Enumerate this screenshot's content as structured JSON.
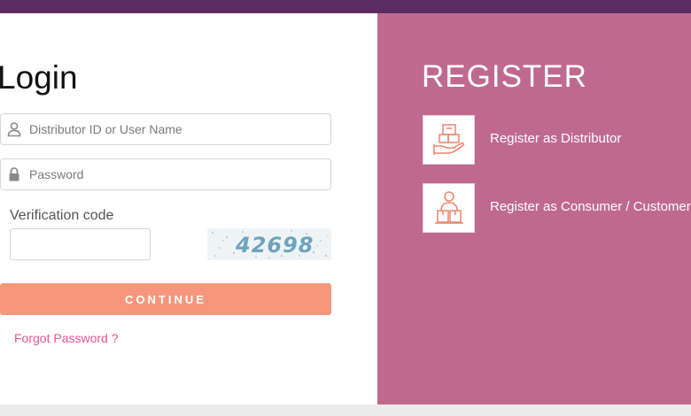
{
  "login": {
    "title": "Login",
    "username_placeholder": "Distributor ID or User Name",
    "password_placeholder": "Password",
    "verification_label": "Verification code",
    "captcha_text": "42698",
    "continue_label": "CONTINUE",
    "forgot_label": "Forgot Password ?",
    "icons": [
      "user-icon",
      "lock-icon"
    ]
  },
  "register": {
    "title": "REGISTER",
    "items": [
      {
        "label": "Register as Distributor",
        "icon": "distributor-box-hand-icon"
      },
      {
        "label": "Register as Consumer / Customer",
        "icon": "consumer-boxes-person-icon"
      }
    ]
  },
  "colors": {
    "topbar": "#5b2b62",
    "register_panel": "#c0698f",
    "continue_button": "#f6977d",
    "forgot_link": "#e6568e",
    "icon_stroke": "#f0846a"
  }
}
